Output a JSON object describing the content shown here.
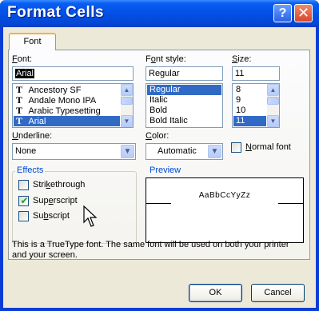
{
  "window": {
    "title": "Format Cells",
    "help_glyph": "?",
    "close_glyph": "✕"
  },
  "tabs": [
    {
      "label": "Font",
      "active": true
    }
  ],
  "font": {
    "label_prefix": "",
    "label_access": "F",
    "label_rest": "ont:",
    "value": "Arial",
    "items": [
      {
        "label": "Ancestory SF",
        "truetype": true,
        "selected": false
      },
      {
        "label": "Andale Mono IPA",
        "truetype": true,
        "selected": false
      },
      {
        "label": "Arabic Typesetting",
        "truetype": true,
        "selected": false
      },
      {
        "label": "Arial",
        "truetype": true,
        "selected": true
      }
    ],
    "truetype_glyph": "T"
  },
  "font_style": {
    "label_prefix": "F",
    "label_access": "o",
    "label_rest": "nt style:",
    "value": "Regular",
    "items": [
      "Regular",
      "Italic",
      "Bold",
      "Bold Italic"
    ],
    "selected": "Regular"
  },
  "size": {
    "label_prefix": "",
    "label_access": "S",
    "label_rest": "ize:",
    "value": "11",
    "items": [
      "8",
      "9",
      "10",
      "11"
    ],
    "selected": "11"
  },
  "underline": {
    "label_prefix": "",
    "label_access": "U",
    "label_rest": "nderline:",
    "value": "None"
  },
  "color": {
    "label_prefix": "",
    "label_access": "C",
    "label_rest": "olor:",
    "value": "Automatic"
  },
  "normal_font": {
    "label_prefix": "",
    "label_access": "N",
    "label_rest": "ormal font",
    "checked": false
  },
  "effects": {
    "title": "Effects",
    "strikethrough": {
      "label_prefix": "Stri",
      "label_access": "k",
      "label_rest": "ethrough",
      "checked": false
    },
    "superscript": {
      "label_prefix": "Sup",
      "label_access": "e",
      "label_rest": "rscript",
      "checked": true
    },
    "subscript": {
      "label_prefix": "Su",
      "label_access": "b",
      "label_rest": "script",
      "checked": false
    },
    "check_glyph": "✔"
  },
  "preview": {
    "title": "Preview",
    "sample": "AaBbCcYyZz"
  },
  "info_text_line1": "This is a TrueType font.  The same font will be used on both your printer",
  "info_text_line2": "and your screen.",
  "buttons": {
    "ok": "OK",
    "cancel": "Cancel"
  },
  "scroll": {
    "up_glyph": "▲",
    "down_glyph": "▼",
    "dropdown_glyph": "▼"
  },
  "colors": {
    "title_bar": "#0351e6",
    "selection": "#316ac5",
    "dialog_bg": "#ece9d8",
    "group_title": "#0046d5"
  }
}
